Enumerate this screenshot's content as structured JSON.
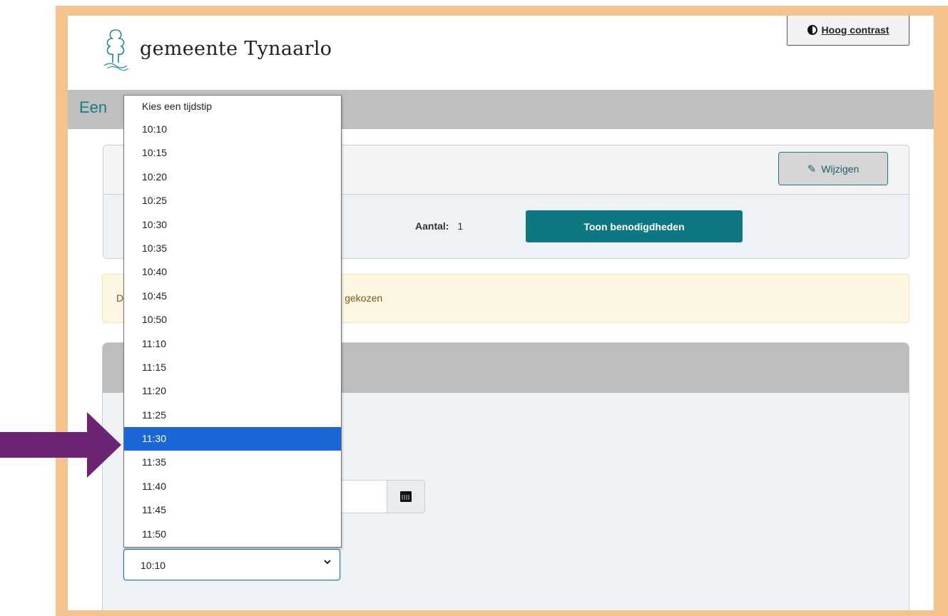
{
  "header": {
    "logo_text": "gemeente Tynaarlo",
    "contrast_button_label": "Hoog contrast"
  },
  "titlebar": {
    "title": "Een"
  },
  "card1": {
    "edit_button_label": "Wijzigen",
    "aantal_label": "Aantal:",
    "aantal_value": "1",
    "toon_button_label": "Toon benodigdheden"
  },
  "alert": {
    "text_start": "D",
    "text_end": "r u gekozen"
  },
  "time_select": {
    "selected_value": "10:10",
    "highlighted_option": "11:30",
    "options": [
      "Kies een tijdstip",
      "10:10",
      "10:15",
      "10:20",
      "10:25",
      "10:30",
      "10:35",
      "10:40",
      "10:45",
      "10:50",
      "11:10",
      "11:15",
      "11:20",
      "11:25",
      "11:30",
      "11:35",
      "11:40",
      "11:45",
      "11:50"
    ]
  },
  "colors": {
    "frame": "#f5c48d",
    "teal": "#0e7882",
    "highlight": "#1a66d2",
    "arrow": "#6b2572"
  },
  "icons": {
    "logo": "tree-logo-icon",
    "contrast": "half-circle-contrast-icon",
    "edit": "pencil-icon",
    "calendar": "calendar-icon",
    "select_chevron": "chevron-down-icon",
    "pointer": "arrow-right-icon"
  }
}
